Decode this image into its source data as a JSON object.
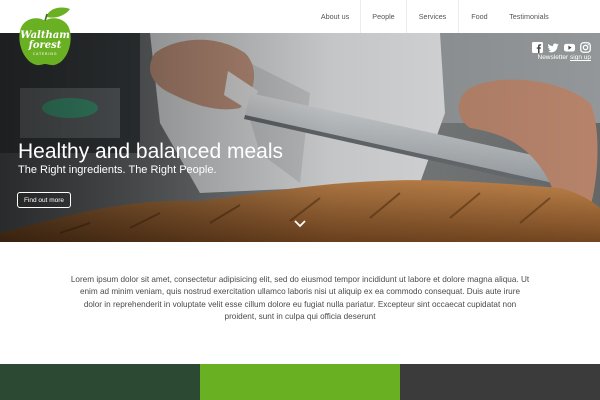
{
  "brand": {
    "logo_text": [
      "Waltham",
      "forest"
    ],
    "logo_subtext": "CATERING",
    "leaf_color": "#6ab023",
    "apple_color": "#6ab023"
  },
  "nav": {
    "items": [
      {
        "label": "About us"
      },
      {
        "label": "People"
      },
      {
        "label": "Services"
      },
      {
        "label": "Food"
      },
      {
        "label": "Testimonials"
      }
    ]
  },
  "hero": {
    "title": "Healthy and balanced meals",
    "subtitle": "The Right ingredients. The Right People.",
    "cta_label": "Find out more",
    "scroll_icon": "chevron-down-icon"
  },
  "social": {
    "icons": [
      "facebook-icon",
      "twitter-icon",
      "youtube-icon",
      "instagram-icon"
    ],
    "newsletter_label": "Newsletter",
    "signup_label": "sign up"
  },
  "intro": {
    "text": "Lorem ipsum dolor sit amet, consectetur adipisicing elit, sed do eiusmod tempor incididunt ut labore et dolore magna aliqua. Ut enim ad minim veniam, quis nostrud exercitation ullamco laboris nisi ut aliquip ex ea commodo consequat. Duis aute irure dolor in reprehenderit in voluptate velit esse cillum dolore eu fugiat nulla pariatur. Excepteur sint occaecat cupidatat non proident, sunt in culpa qui officia deserunt"
  },
  "footer_bands": {
    "colors": [
      "#2c4a33",
      "#6ab023",
      "#3b3b3b"
    ]
  }
}
